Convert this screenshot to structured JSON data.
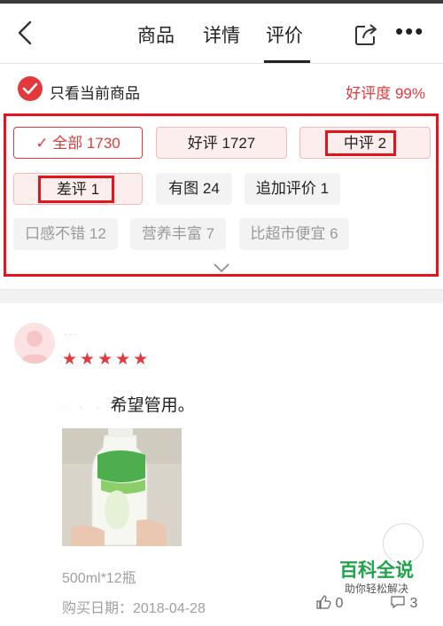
{
  "nav": {
    "tabs": [
      "商品",
      "详情",
      "评价"
    ],
    "active_tab": "评价"
  },
  "filter": {
    "only_current_label": "只看当前商品",
    "positive_rate": "好评度 99%"
  },
  "tags": {
    "all": "✓ 全部 1730",
    "good": "好评 1727",
    "medium": "中评 2",
    "bad": "差评 1",
    "with_pic": "有图 24",
    "follow_up": "追加评价 1",
    "taste": "口感不错 12",
    "nutrition": "营养丰富 7",
    "cheaper": "比超市便宜 6"
  },
  "review": {
    "stars": "★★★★★",
    "text": "希望管用。",
    "spec": "500ml*12瓶",
    "purchase_date": "购买日期：2018-04-28",
    "like_count": "0",
    "comment_count": "3"
  },
  "watermark": {
    "title": "百科全说",
    "subtitle": "助你轻松解决"
  },
  "colors": {
    "accent": "#e4393c",
    "highlight": "#e3141e"
  }
}
